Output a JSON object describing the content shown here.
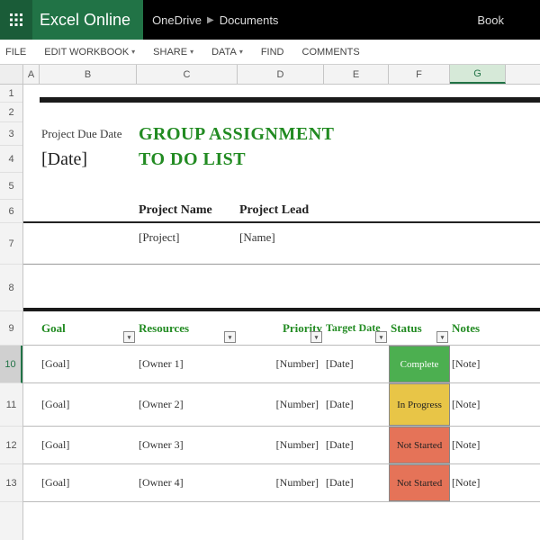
{
  "header": {
    "app_name": "Excel Online",
    "breadcrumb": [
      "OneDrive",
      "Documents"
    ],
    "doc_name": "Book"
  },
  "menu": {
    "file": "FILE",
    "edit_workbook": "EDIT WORKBOOK",
    "share": "SHARE",
    "data": "DATA",
    "find": "FIND",
    "comments": "COMMENTS"
  },
  "columns": [
    "A",
    "B",
    "C",
    "D",
    "E",
    "F",
    "G"
  ],
  "selected_column": "G",
  "rows": [
    "1",
    "2",
    "3",
    "4",
    "5",
    "6",
    "7",
    "8",
    "9",
    "10",
    "11",
    "12",
    "13"
  ],
  "selected_row": "10",
  "doc": {
    "due_date_label": "Project Due Date",
    "due_date_value": "[Date]",
    "title_line1": "GROUP ASSIGNMENT",
    "title_line2": "TO DO LIST",
    "proj_name_hdr": "Project Name",
    "proj_lead_hdr": "Project Lead",
    "proj_name_val": "[Project]",
    "proj_lead_val": "[Name]",
    "table_headers": {
      "goal": "Goal",
      "resources": "Resources",
      "priority": "Priority",
      "target": "Target Date",
      "status": "Status",
      "notes": "Notes"
    },
    "table_rows": [
      {
        "goal": "[Goal]",
        "resources": "[Owner 1]",
        "priority": "[Number]",
        "target": "[Date]",
        "status": "Complete",
        "status_class": "status-complete",
        "notes": "[Note]"
      },
      {
        "goal": "[Goal]",
        "resources": "[Owner 2]",
        "priority": "[Number]",
        "target": "[Date]",
        "status": "In Progress",
        "status_class": "status-inprogress",
        "notes": "[Note]"
      },
      {
        "goal": "[Goal]",
        "resources": "[Owner 3]",
        "priority": "[Number]",
        "target": "[Date]",
        "status": "Not Started",
        "status_class": "status-notstarted",
        "notes": "[Note]"
      },
      {
        "goal": "[Goal]",
        "resources": "[Owner 4]",
        "priority": "[Number]",
        "target": "[Date]",
        "status": "Not Started",
        "status_class": "status-notstarted",
        "notes": "[Note]"
      }
    ]
  }
}
